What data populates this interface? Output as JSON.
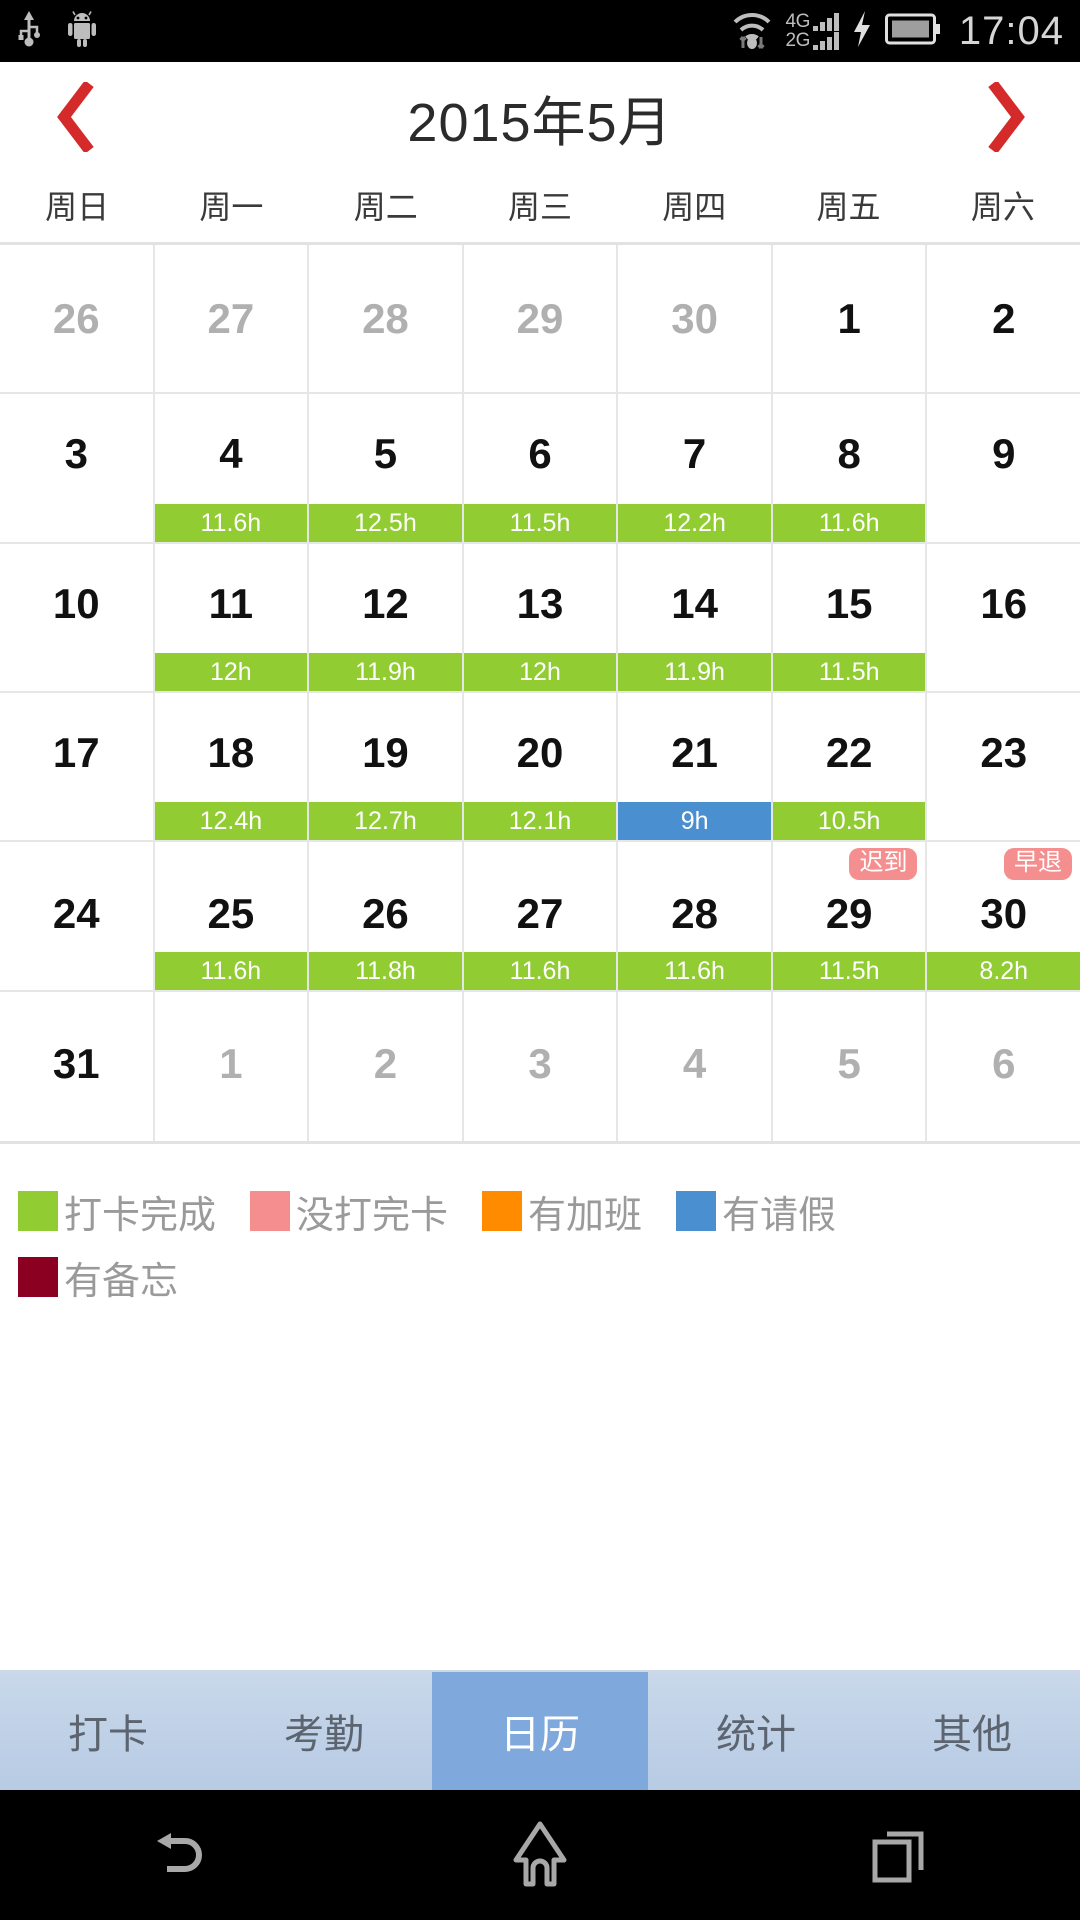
{
  "statusbar": {
    "icons": [
      "usb-icon",
      "android-robot-icon",
      "wifi-icon",
      "charging-bolt-icon",
      "battery-icon"
    ],
    "net_primary": "4G",
    "net_secondary": "2G",
    "time": "17:04"
  },
  "header": {
    "prev_label": "‹",
    "next_label": "›",
    "title": "2015年5月",
    "arrow_color": "#d42a2a"
  },
  "weekdays": [
    "周日",
    "周一",
    "周二",
    "周三",
    "周四",
    "周五",
    "周六"
  ],
  "colors": {
    "done": "#92cc33",
    "incomplete": "#f58f8f",
    "overtime": "#ff8c00",
    "leave": "#4a90d0",
    "memo": "#8b0020"
  },
  "weeks": [
    [
      {
        "day": "26",
        "other": true
      },
      {
        "day": "27",
        "other": true
      },
      {
        "day": "28",
        "other": true
      },
      {
        "day": "29",
        "other": true
      },
      {
        "day": "30",
        "other": true
      },
      {
        "day": "1",
        "other": false
      },
      {
        "day": "2",
        "other": false
      }
    ],
    [
      {
        "day": "3",
        "other": false
      },
      {
        "day": "4",
        "other": false,
        "hours": "11.6h",
        "status": "done"
      },
      {
        "day": "5",
        "other": false,
        "hours": "12.5h",
        "status": "done"
      },
      {
        "day": "6",
        "other": false,
        "hours": "11.5h",
        "status": "done"
      },
      {
        "day": "7",
        "other": false,
        "hours": "12.2h",
        "status": "done"
      },
      {
        "day": "8",
        "other": false,
        "hours": "11.6h",
        "status": "done"
      },
      {
        "day": "9",
        "other": false
      }
    ],
    [
      {
        "day": "10",
        "other": false
      },
      {
        "day": "11",
        "other": false,
        "hours": "12h",
        "status": "done"
      },
      {
        "day": "12",
        "other": false,
        "hours": "11.9h",
        "status": "done"
      },
      {
        "day": "13",
        "other": false,
        "hours": "12h",
        "status": "done"
      },
      {
        "day": "14",
        "other": false,
        "hours": "11.9h",
        "status": "done"
      },
      {
        "day": "15",
        "other": false,
        "hours": "11.5h",
        "status": "done"
      },
      {
        "day": "16",
        "other": false
      }
    ],
    [
      {
        "day": "17",
        "other": false
      },
      {
        "day": "18",
        "other": false,
        "hours": "12.4h",
        "status": "done"
      },
      {
        "day": "19",
        "other": false,
        "hours": "12.7h",
        "status": "done"
      },
      {
        "day": "20",
        "other": false,
        "hours": "12.1h",
        "status": "done"
      },
      {
        "day": "21",
        "other": false,
        "hours": "9h",
        "status": "leave"
      },
      {
        "day": "22",
        "other": false,
        "hours": "10.5h",
        "status": "done"
      },
      {
        "day": "23",
        "other": false
      }
    ],
    [
      {
        "day": "24",
        "other": false
      },
      {
        "day": "25",
        "other": false,
        "hours": "11.6h",
        "status": "done"
      },
      {
        "day": "26",
        "other": false,
        "hours": "11.8h",
        "status": "done"
      },
      {
        "day": "27",
        "other": false,
        "hours": "11.6h",
        "status": "done"
      },
      {
        "day": "28",
        "other": false,
        "hours": "11.6h",
        "status": "done"
      },
      {
        "day": "29",
        "other": false,
        "hours": "11.5h",
        "status": "done",
        "badge": "迟到"
      },
      {
        "day": "30",
        "other": false,
        "hours": "8.2h",
        "status": "done",
        "badge": "早退"
      }
    ],
    [
      {
        "day": "31",
        "other": false
      },
      {
        "day": "1",
        "other": true
      },
      {
        "day": "2",
        "other": true
      },
      {
        "day": "3",
        "other": true
      },
      {
        "day": "4",
        "other": true
      },
      {
        "day": "5",
        "other": true
      },
      {
        "day": "6",
        "other": true
      }
    ]
  ],
  "legend": [
    {
      "label": "打卡完成",
      "color": "#92cc33"
    },
    {
      "label": "没打完卡",
      "color": "#f58f8f"
    },
    {
      "label": "有加班",
      "color": "#ff8c00"
    },
    {
      "label": "有请假",
      "color": "#4a90d0"
    },
    {
      "label": "有备忘",
      "color": "#8b0020"
    }
  ],
  "tabs": [
    {
      "label": "打卡",
      "active": false
    },
    {
      "label": "考勤",
      "active": false
    },
    {
      "label": "日历",
      "active": true
    },
    {
      "label": "统计",
      "active": false
    },
    {
      "label": "其他",
      "active": false
    }
  ],
  "navbar": {
    "back": "back-icon",
    "home": "home-icon",
    "recents": "recent-apps-icon"
  }
}
